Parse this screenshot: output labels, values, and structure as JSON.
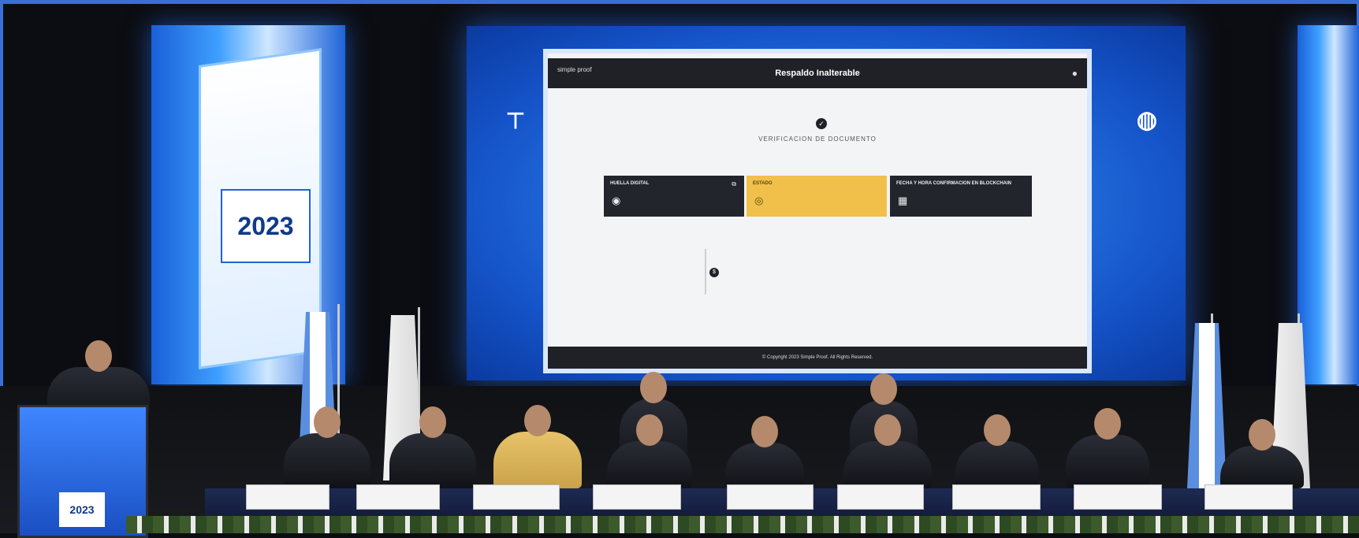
{
  "screen": {
    "app_title": "Respaldo Inalterable",
    "brand": "simple proof",
    "section_title": "VERIFICACION DE DOCUMENTO",
    "section_subtitle": "",
    "card_hash_label": "HUELLA DIGITAL",
    "card_status_label": "ESTADO",
    "card_date_label": "FECHA Y HORA CONFIRMACION EN BLOCKCHAIN",
    "footer_text": "© Copyright 2023 Simple Proof. All Rights Reserved."
  },
  "event": {
    "badge_year": "2023"
  },
  "colors": {
    "accent_blue": "#1e63d8",
    "status_yellow": "#f0c04b",
    "app_dark": "#1f2127"
  }
}
